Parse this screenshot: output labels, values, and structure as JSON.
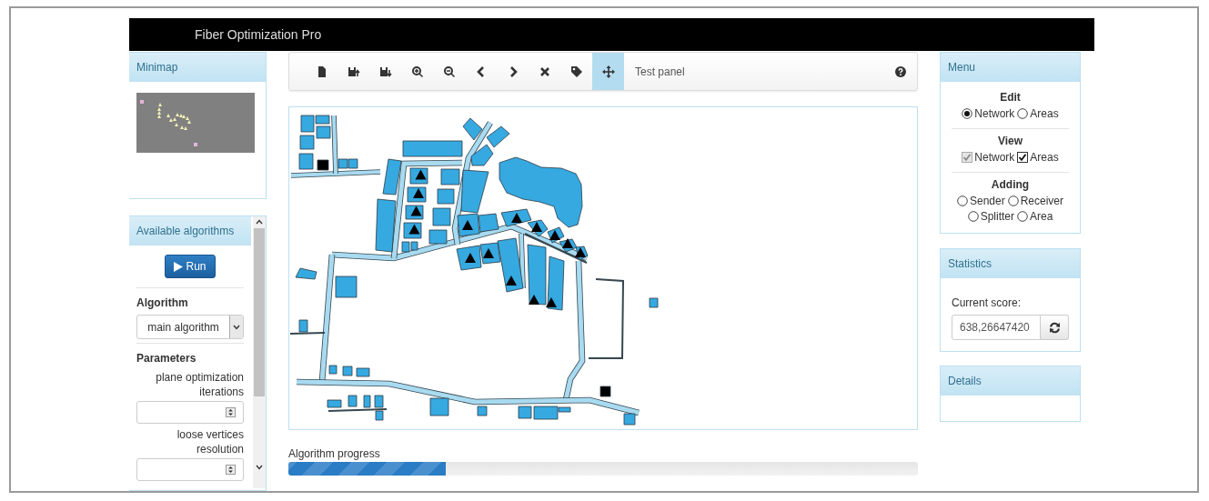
{
  "header": {
    "title": "Fiber Optimization Pro"
  },
  "minimap": {
    "title": "Minimap"
  },
  "algorithms": {
    "title": "Available algorithms",
    "run_button": "Run",
    "algorithm_label": "Algorithm",
    "algorithm_value": "main algorithm",
    "parameters_label": "Parameters",
    "parameters": [
      {
        "label": "plane optimization iterations"
      },
      {
        "label": "loose vertices resolution"
      }
    ]
  },
  "toolbar": {
    "tools": [
      {
        "kind": "file",
        "selected": false
      },
      {
        "kind": "save-up",
        "selected": false
      },
      {
        "kind": "save-down",
        "selected": false
      },
      {
        "kind": "zoom-in",
        "selected": false
      },
      {
        "kind": "zoom-out",
        "selected": false
      },
      {
        "kind": "prev",
        "selected": false
      },
      {
        "kind": "next",
        "selected": false
      },
      {
        "kind": "delete",
        "selected": false
      },
      {
        "kind": "tag",
        "selected": false
      },
      {
        "kind": "move",
        "selected": true
      }
    ],
    "panel_label": "Test panel"
  },
  "progress": {
    "label": "Algorithm progress",
    "level": 0.25
  },
  "menu": {
    "title": "Menu",
    "sections": [
      {
        "title": "Edit",
        "kind": "radio",
        "rows": [
          [
            {
              "label": "Network",
              "selected": true
            },
            {
              "label": "Areas",
              "selected": false
            }
          ]
        ]
      },
      {
        "title": "View",
        "kind": "checkbox",
        "rows": [
          [
            {
              "label": "Network",
              "checked": true,
              "disabled": true
            },
            {
              "label": "Areas",
              "checked": true,
              "disabled": false
            }
          ]
        ]
      },
      {
        "title": "Adding",
        "kind": "radio",
        "rows": [
          [
            {
              "label": "Sender",
              "selected": false
            },
            {
              "label": "Receiver",
              "selected": false
            }
          ],
          [
            {
              "label": "Splitter",
              "selected": false
            },
            {
              "label": "Area",
              "selected": false
            }
          ]
        ]
      }
    ]
  },
  "statistics": {
    "title": "Statistics",
    "score_label": "Current score:",
    "score_value": "638,26647420"
  },
  "details": {
    "title": "Details"
  }
}
